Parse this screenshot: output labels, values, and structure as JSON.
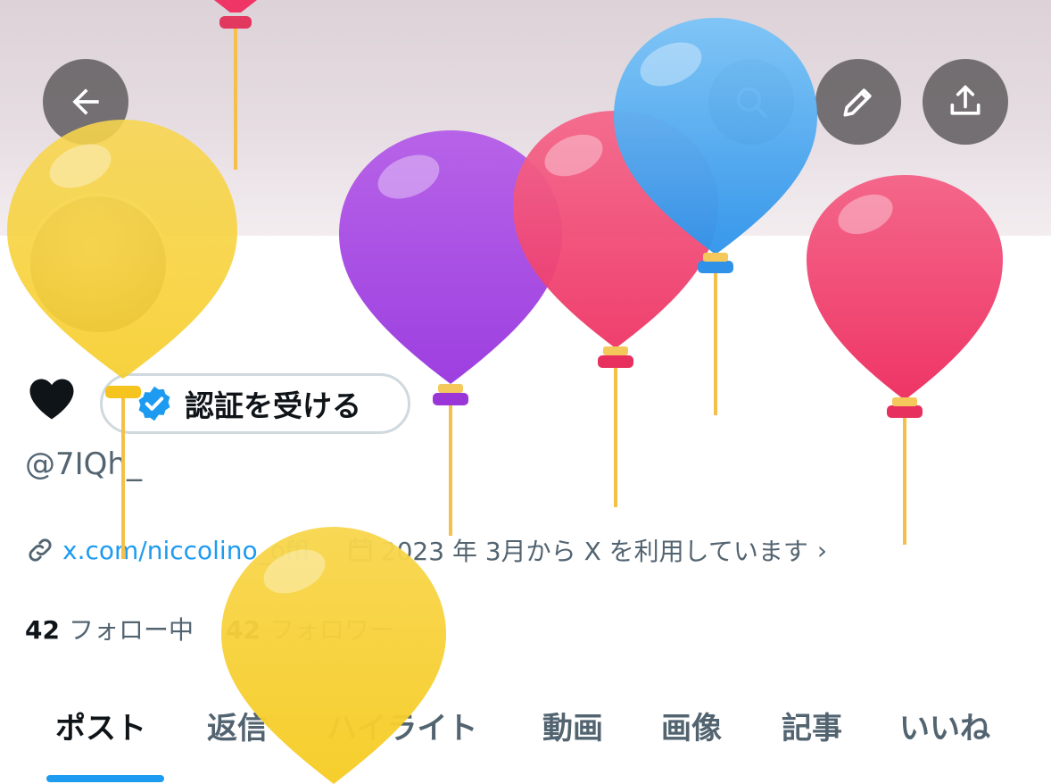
{
  "profile": {
    "name_glyph": "♥",
    "verify_label": "認証を受ける",
    "handle": "@7IQh_",
    "link_text": "x.com/niccolino_offl",
    "joined_text": "2023 年 3月から X を利用しています",
    "following_count": "42",
    "following_label": "フォロー中",
    "followers_count": "42",
    "followers_label": "フォロワー"
  },
  "tabs": [
    {
      "label": "ポスト"
    },
    {
      "label": "返信"
    },
    {
      "label": "ハイライト"
    },
    {
      "label": "動画"
    },
    {
      "label": "画像"
    },
    {
      "label": "記事"
    },
    {
      "label": "いいね"
    }
  ],
  "active_tab": "ポスト",
  "icons": {
    "back": "arrow-left-icon",
    "search": "search-icon",
    "edit": "pencil-icon",
    "share": "share-icon",
    "verified": "verified-badge-icon",
    "link": "link-icon",
    "calendar": "calendar-icon"
  },
  "colors": {
    "accent": "#1d9bf0",
    "text": "#0f1419",
    "secondary_text": "#536471",
    "balloon_yellow": "#f9d43a",
    "balloon_purple": "#a64ee3",
    "balloon_red": "#f0466e",
    "balloon_blue": "#4aa8f2"
  }
}
